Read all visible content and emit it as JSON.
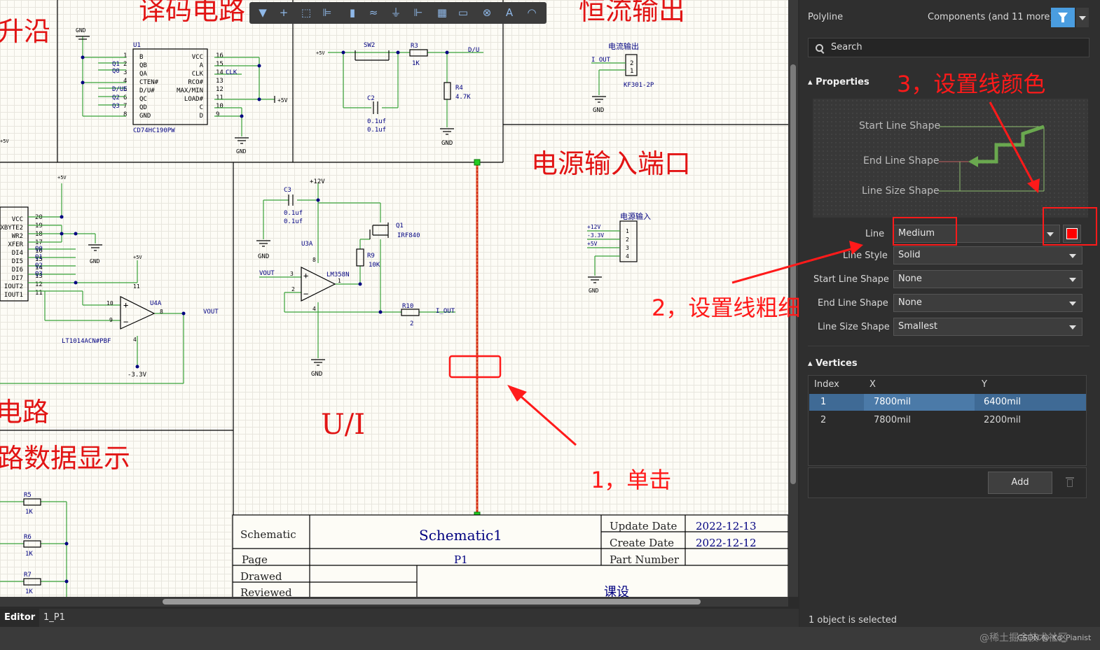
{
  "canvas": {
    "section_titles": [
      "升沿",
      "译码电路",
      "恒流输出",
      "电源输入端口",
      "电路",
      "路数据显示",
      "U/I"
    ],
    "ic_u1": {
      "ref": "U1",
      "part": "CD74HC190PW",
      "left_pins": [
        "B",
        "QB",
        "QA",
        "CTEN#",
        "D/U#",
        "QC",
        "QD",
        "GND"
      ],
      "left_nums": [
        "1",
        "2",
        "3",
        "4",
        "5",
        "6",
        "7",
        "8"
      ],
      "right_pins": [
        "VCC",
        "A",
        "CLK",
        "RCO#",
        "MAX/MIN",
        "LOAD#",
        "C",
        "D"
      ],
      "right_nums": [
        "16",
        "15",
        "14",
        "13",
        "12",
        "11",
        "10",
        "9"
      ],
      "left_nets": [
        "Q1",
        "Q0",
        "D/UE",
        "Q2",
        "Q3"
      ],
      "clk_net": "CLK"
    },
    "power_labels": {
      "gnd": "GND",
      "p5v": "+5V",
      "p12v": "+12V",
      "m33v": "-3.3V"
    },
    "sw2": "SW2",
    "r3": {
      "ref": "R3",
      "val": "1K"
    },
    "r4": {
      "ref": "R4",
      "val": "4.7K"
    },
    "c2": {
      "ref": "C2",
      "val1": "0.1uf",
      "val2": "0.1uf"
    },
    "du_net": "D/U",
    "out_connector": {
      "title": "电流输出",
      "net": "I_OUT",
      "part": "KF301-2P",
      "pins": [
        "2",
        "1"
      ]
    },
    "dac": {
      "pins": [
        "VCC",
        "XBYTE2",
        "WR2",
        "XFER",
        "DI4",
        "DI5",
        "DI6",
        "DI7",
        "IOUT2",
        "IOUT1"
      ],
      "nums": [
        "20",
        "19",
        "18",
        "17",
        "16",
        "15",
        "14",
        "13",
        "12",
        "11"
      ],
      "nets": [
        "Q0",
        "Q1",
        "Q2",
        "Q3"
      ]
    },
    "u4a": {
      "ref": "U4A",
      "part": "LT1014ACN#PBF",
      "pins": [
        "10",
        "9",
        "8",
        "11",
        "4"
      ],
      "out": "VOUT"
    },
    "c3": {
      "ref": "C3",
      "val1": "0.1uf",
      "val2": "0.1uf"
    },
    "u3a": {
      "ref": "U3A",
      "part": "LM358N",
      "pins": [
        "3",
        "2",
        "1",
        "8",
        "4"
      ],
      "in": "VOUT"
    },
    "q1": {
      "ref": "Q1",
      "part": "IRF840"
    },
    "r9": {
      "ref": "R9",
      "val": "10K"
    },
    "r10": {
      "ref": "R10",
      "val": "2",
      "net": "I_OUT"
    },
    "in_connector": {
      "title": "电源输入",
      "nets": [
        "+12V",
        "-3.3V",
        "+5V"
      ],
      "pins": [
        "1",
        "2",
        "3",
        "4"
      ]
    },
    "res_left": [
      {
        "ref": "R5",
        "val": "1K"
      },
      {
        "ref": "R6",
        "val": "1K"
      },
      {
        "ref": "R7",
        "val": "1K"
      }
    ],
    "title_block": {
      "schematic_label": "Schematic",
      "schematic_name": "Schematic1",
      "update_label": "Update Date",
      "update_value": "2022-12-13",
      "create_label": "Create Date",
      "create_value": "2022-12-12",
      "page_label": "Page",
      "page_value": "P1",
      "part_label": "Part Number",
      "drawed_label": "Drawed",
      "reviewed_label": "Reviewed",
      "kese": "课设"
    }
  },
  "annotations": {
    "step1": "1，单击",
    "step2": "2，设置线粗细",
    "step3": "3，设置线颜色"
  },
  "tabs": {
    "editor": "Editor",
    "sheet": "1_P1"
  },
  "panel": {
    "object_type": "Polyline",
    "filter_label": "Components (and 11 more)",
    "search_placeholder": "Search",
    "properties_header": "Properties",
    "preview": {
      "start": "Start Line Shape",
      "end": "End Line Shape",
      "size": "Line Size Shape"
    },
    "fields": {
      "line_label": "Line",
      "line_value": "Medium",
      "line_style_label": "Line Style",
      "line_style_value": "Solid",
      "start_label": "Start Line Shape",
      "start_value": "None",
      "end_label": "End Line Shape",
      "end_value": "None",
      "size_label": "Line Size Shape",
      "size_value": "Smallest"
    },
    "line_color": "#ff0000",
    "vertices_header": "Vertices",
    "table": {
      "headers": [
        "Index",
        "X",
        "Y"
      ],
      "rows": [
        [
          "1",
          "7800mil",
          "6400mil"
        ],
        [
          "2",
          "7800mil",
          "2200mil"
        ]
      ]
    },
    "add_button": "Add",
    "status": "1 object is selected"
  },
  "watermark": "@稀土掘金技术社区",
  "watermark2": "CSDN @ Kd_Pianist",
  "colors": {
    "accent": "#4a9de0",
    "annotation": "#ff1a1a",
    "wire": "#3aa23a",
    "component": "#000080"
  }
}
